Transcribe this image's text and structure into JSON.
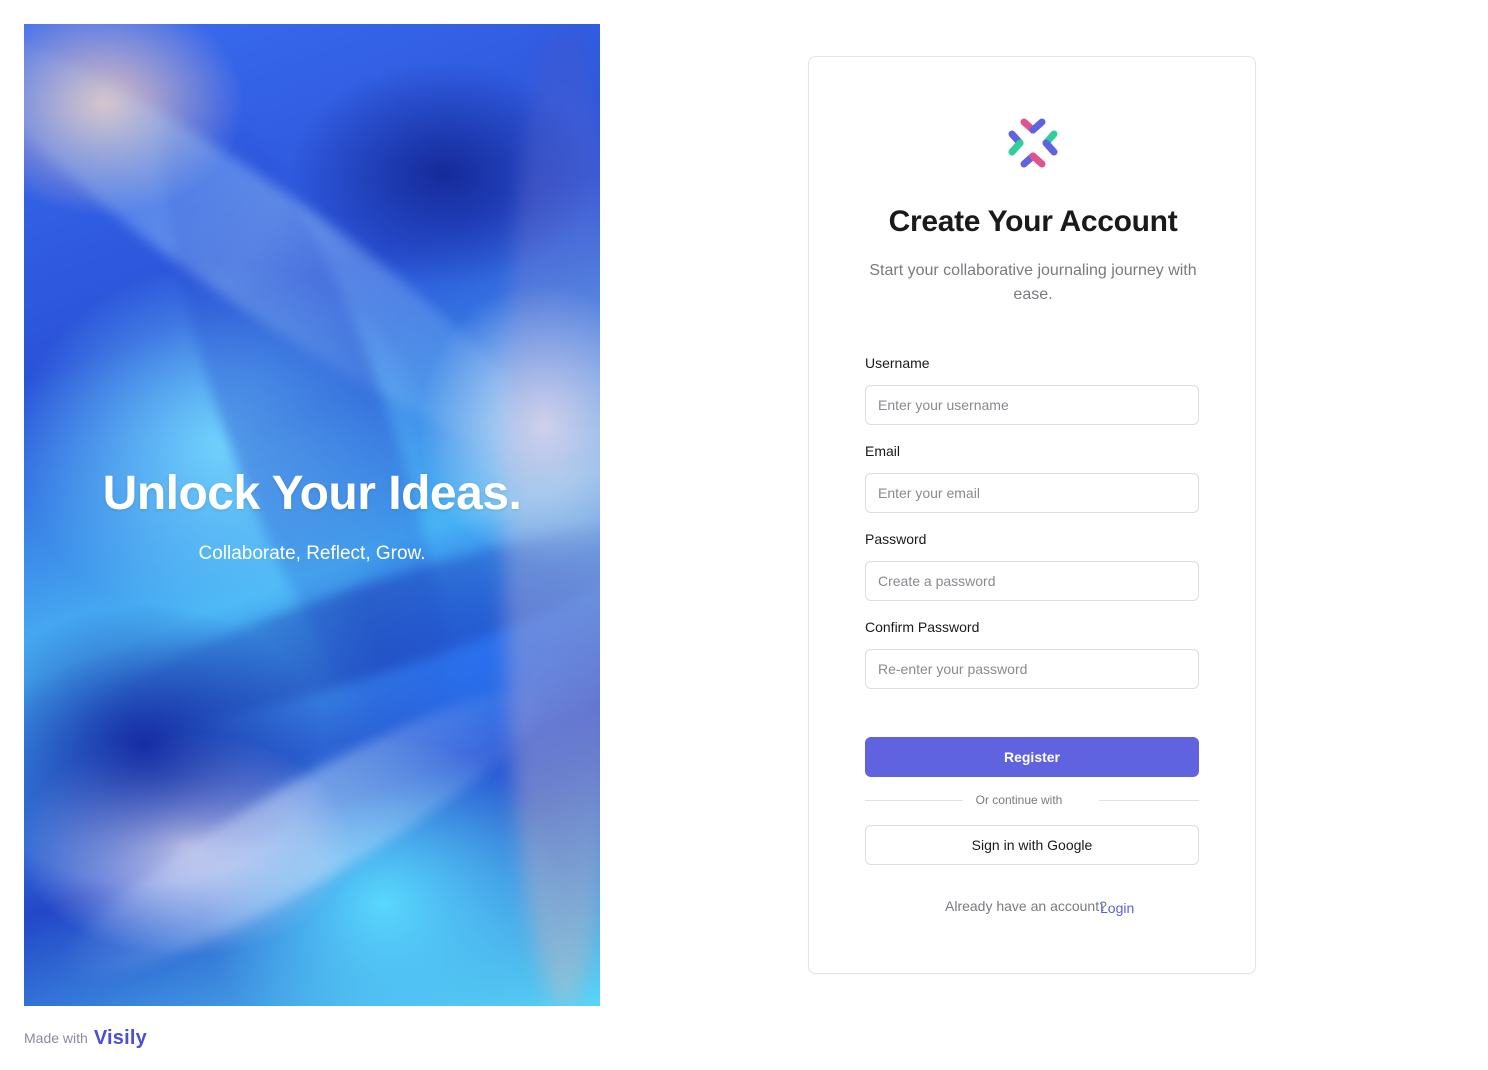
{
  "hero": {
    "title": "Unlock Your Ideas.",
    "subtitle": "Collaborate, Reflect, Grow."
  },
  "footer": {
    "made_with": "Made with",
    "brand": "Visily"
  },
  "card": {
    "logo_icon": "app-logo-icon",
    "title": "Create Your Account",
    "subtitle": "Start your collaborative journaling journey with ease.",
    "fields": {
      "username": {
        "label": "Username",
        "placeholder": "Enter your username",
        "value": ""
      },
      "email": {
        "label": "Email",
        "placeholder": "Enter your email",
        "value": ""
      },
      "password": {
        "label": "Password",
        "placeholder": "Create a password",
        "value": ""
      },
      "confirm_password": {
        "label": "Confirm Password",
        "placeholder": "Re-enter your password",
        "value": ""
      }
    },
    "register_label": "Register",
    "divider_text": "Or continue with",
    "google_label": "Sign in with Google",
    "login_prompt": "Already have an account?",
    "login_link": "Login"
  },
  "colors": {
    "primary": "#6063e0",
    "link": "#5b5fd9",
    "muted_text": "#7a7a80",
    "border": "#dcdce2"
  }
}
